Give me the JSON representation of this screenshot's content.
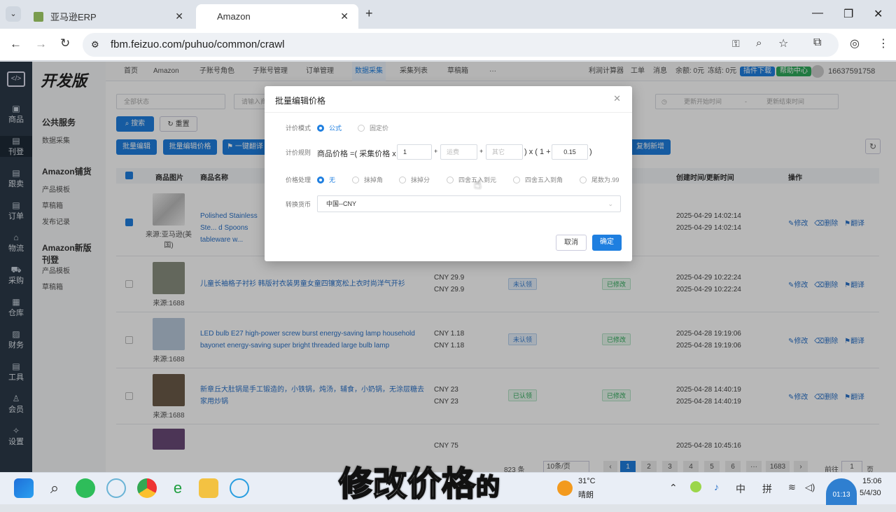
{
  "browser": {
    "tabs": [
      {
        "label": "亚马逊ERP"
      },
      {
        "label": "Amazon"
      }
    ],
    "url": "fbm.feizuo.com/puhuo/common/crawl"
  },
  "app": {
    "logo": "开发版",
    "leftnav": [
      "商品",
      "刊登",
      "跟卖",
      "订单",
      "物流",
      "采购",
      "仓库",
      "财务",
      "工具",
      "会员",
      "设置"
    ],
    "menu": {
      "group1": "公共服务",
      "group1_items": [
        "数据采集"
      ],
      "group2": "Amazon铺货",
      "group2_items": [
        "产品模板",
        "草稿箱",
        "发布记录"
      ],
      "group3": "Amazon新版刊登",
      "group3_items": [
        "产品模板",
        "草稿箱"
      ]
    },
    "top_tabs": [
      "首页",
      "Amazon",
      "子账号角色",
      "子账号管理",
      "订单管理",
      "数据采集",
      "采集列表",
      "草稿箱",
      "···"
    ],
    "top_right": {
      "calc": "利润计算器",
      "ticket": "工单",
      "msg": "消息",
      "balance": "余额: 0元",
      "frozen": "冻结: 0元",
      "plugin": "插件下载",
      "help": "帮助中心",
      "account": "16637591758"
    },
    "filters": {
      "status": "全部状态",
      "input_placeholder": "请输入商",
      "start_time": "更新开始时间",
      "dash": "-",
      "end_time": "更新结束时间"
    },
    "buttons": {
      "search": "搜索",
      "reset": "重置",
      "bulk_edit": "批量编辑",
      "bulk_price": "批量编辑价格",
      "translate": "一键翻译",
      "copy_new": "复制新增"
    },
    "table": {
      "headers": [
        "商品图片",
        "商品名称",
        "创建时间/更新时间",
        "操作"
      ],
      "ops": {
        "edit": "修改",
        "delete": "删除",
        "translate": "翻译"
      },
      "rows": [
        {
          "source": "来源:亚马逊(美国)",
          "name": "Polished Stainless Ste... d Spoons tableware w...",
          "price1": "",
          "price2": "",
          "status1": "",
          "status2": "",
          "created": "2025-04-29 14:02:14",
          "updated": "2025-04-29 14:02:14"
        },
        {
          "source": "来源:1688",
          "name": "儿童长袖格子衬衫 韩版衬衣装男童女童四镶宽松上衣时尚洋气开衫",
          "price1": "CNY 29.9",
          "price2": "CNY 29.9",
          "status1": "未认领",
          "status2": "已修改",
          "created": "2025-04-29 10:22:24",
          "updated": "2025-04-29 10:22:24"
        },
        {
          "source": "来源:1688",
          "name": "LED bulb E27 high-power screw burst energy-saving lamp household bayonet energy-saving super bright threaded large bulb lamp",
          "price1": "CNY 1.18",
          "price2": "CNY 1.18",
          "status1": "未认领",
          "status2": "已修改",
          "created": "2025-04-28 19:19:06",
          "updated": "2025-04-28 19:19:06"
        },
        {
          "source": "来源:1688",
          "name": "新章丘大肚锅是手工锻造的，小铁锅，炖汤，辅食，小奶锅，无涂层糖去家用炒锅",
          "price1": "CNY 23",
          "price2": "CNY 23",
          "status1": "已认领",
          "status2": "已修改",
          "created": "2025-04-28 14:40:19",
          "updated": "2025-04-28 14:40:19"
        },
        {
          "source": "",
          "name": "",
          "price1": "CNY 75",
          "price2": "",
          "status1": "",
          "status2": "",
          "created": "2025-04-28 10:45:16",
          "updated": ""
        }
      ]
    },
    "pagination": {
      "total": "823 条",
      "page_size": "10条/页",
      "pages": [
        "1",
        "2",
        "3",
        "4",
        "5",
        "6",
        "···",
        "1683"
      ],
      "goto": "前往",
      "goto_value": "1",
      "page_unit": "页"
    }
  },
  "modal": {
    "title": "批量编辑价格",
    "pricing_mode_label": "计价模式",
    "pricing_modes": [
      "公式",
      "固定价"
    ],
    "rule_label": "计价规则",
    "rule_prefix": "商品价格 =( 采集价格 x",
    "multiplier": "1",
    "plus1": "+",
    "shipping_placeholder": "运费",
    "plus2": "+",
    "other_placeholder": "其它",
    "times_text": ") x ( 1 +",
    "rate": "0.15",
    "close_paren": ")",
    "rounding_label": "价格处理",
    "rounding_options": [
      "无",
      "抹掉角",
      "抹掉分",
      "四舍五入到元",
      "四舍五入到角",
      "尾数为.99"
    ],
    "currency_label": "转换货币",
    "currency_value": "中国--CNY",
    "cancel": "取消",
    "confirm": "确定"
  },
  "taskbar": {
    "weather_temp": "31°C",
    "weather_desc": "晴朗",
    "ime1": "中",
    "ime2": "拼",
    "time": "15:06",
    "date": "5/4/30",
    "timer": "01:13"
  },
  "subtitle": {
    "main": "修改价格",
    "tail": "的"
  },
  "colors": {
    "primary": "#1f7fe0",
    "nav_dark": "#2c3a48"
  }
}
